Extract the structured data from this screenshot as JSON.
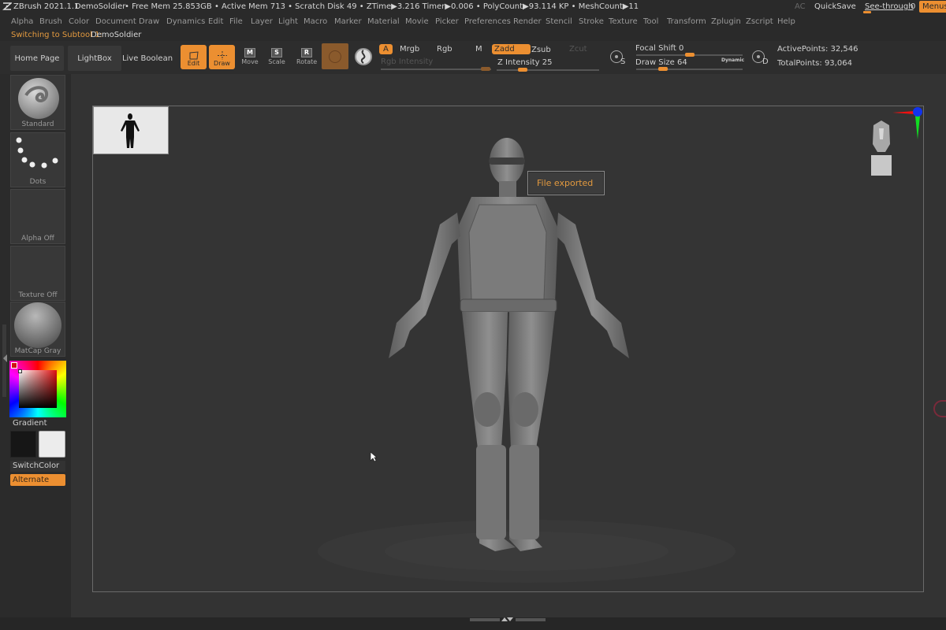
{
  "titlebar": {
    "app": "ZBrush 2021.1.1",
    "document": "DemoSoldier",
    "stats": "• Free Mem 25.853GB • Active Mem 713 • Scratch Disk 49 • ZTime▶3.216 Timer▶0.006 • PolyCount▶93.114 KP • MeshCount▶11",
    "ac": "AC",
    "quicksave": "QuickSave",
    "see_through_label": "See-through",
    "see_through_value": "0",
    "see_through_fraction": 0.0,
    "menus_button": "Menus"
  },
  "menubar": {
    "items": [
      "Alpha",
      "Brush",
      "Color",
      "Document",
      "Draw",
      "Dynamics",
      "Edit",
      "File",
      "Layer",
      "Light",
      "Macro",
      "Marker",
      "Material",
      "Movie",
      "Picker",
      "Preferences",
      "Render",
      "Stencil",
      "Stroke",
      "Texture",
      "Tool",
      "Transform",
      "Zplugin",
      "Zscript",
      "Help"
    ]
  },
  "status": {
    "message": "Switching to Subtool 1:",
    "subtool": "DemoSoldier"
  },
  "toolbar": {
    "home_page": "Home Page",
    "lightbox": "LightBox",
    "live_boolean": "Live Boolean",
    "edit": "Edit",
    "draw": "Draw",
    "move": "Move",
    "move_key": "M",
    "scale": "Scale",
    "scale_key": "S",
    "rotate": "Rotate",
    "rotate_key": "R",
    "a_toggle": "A",
    "mrgb": "Mrgb",
    "rgb": "Rgb",
    "m": "M",
    "zadd": "Zadd",
    "zsub": "Zsub",
    "zcut": "Zcut",
    "rgb_intensity_label": "Rgb Intensity",
    "rgb_intensity_fraction": 0.95,
    "z_intensity_label": "Z Intensity",
    "z_intensity_value": "25",
    "z_intensity_fraction": 0.25,
    "focal_shift_label": "Focal Shift",
    "focal_shift_value": "0",
    "focal_shift_fraction": 0.5,
    "draw_size_label": "Draw Size",
    "draw_size_value": "64",
    "draw_size_fraction": 0.25,
    "dynamic": "Dynamic",
    "s_key": "S",
    "d_key": "D",
    "active_points": "ActivePoints: 32,546",
    "total_points": "TotalPoints: 93,064"
  },
  "leftpanel": {
    "brush": "Standard",
    "stroke": "Dots",
    "alpha": "Alpha Off",
    "texture": "Texture Off",
    "material": "MatCap Gray",
    "gradient": "Gradient",
    "switch_color": "SwitchColor",
    "alternate": "Alternate"
  },
  "viewport": {
    "tooltip": "File exported"
  },
  "colors": {
    "accent": "#ec8f31",
    "background": "#2c2c2c",
    "viewport": "#343434",
    "tooltip_text": "#e39a3f"
  }
}
